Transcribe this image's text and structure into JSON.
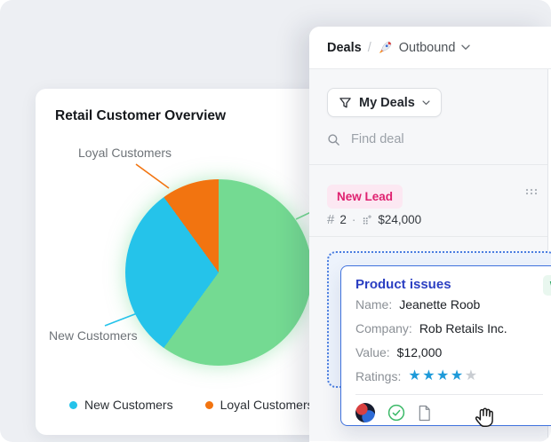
{
  "chart_data": {
    "type": "pie",
    "title": "Retail Customer Overview",
    "slices": [
      {
        "label": "",
        "value": 60,
        "color": "#74da92"
      },
      {
        "label": "New Customers",
        "value": 30,
        "color": "#25c3ea"
      },
      {
        "label": "Loyal Customers",
        "value": 10,
        "color": "#f27410"
      }
    ],
    "start_angle_deg": 0,
    "direction": "clockwise",
    "legend": {
      "position": "bottom",
      "items": [
        "New Customers",
        "Loyal Customers"
      ]
    }
  },
  "overview_card": {
    "title": "Retail Customer Overview"
  },
  "deals_panel": {
    "header": {
      "title": "Deals",
      "separator": "/",
      "pipeline": "Outbound"
    },
    "filter_button": {
      "label": "My Deals"
    },
    "search": {
      "placeholder": "Find deal"
    },
    "stage": {
      "badge_label": "New Lead",
      "badge_text_color": "#df2170",
      "badge_bg_color": "#fce8f2",
      "deal_count": "2",
      "separator": "·",
      "total_value": "$24,000"
    },
    "deal_card": {
      "title": "Product issues",
      "title_color": "#2b3fc2",
      "status_badge": {
        "label": "W",
        "text_color": "#27a35e",
        "bg_color": "#e9f7ef"
      },
      "fields": [
        {
          "label": "Name:",
          "value": "Jeanette Roob"
        },
        {
          "label": "Company:",
          "value": "Rob Retails Inc."
        },
        {
          "label": "Value:",
          "value": "$12,000"
        }
      ],
      "rating": {
        "label": "Ratings:",
        "filled": 4,
        "total": 5,
        "filled_color": "#1e9ad9",
        "empty_color": "#c9cdd2"
      }
    }
  }
}
